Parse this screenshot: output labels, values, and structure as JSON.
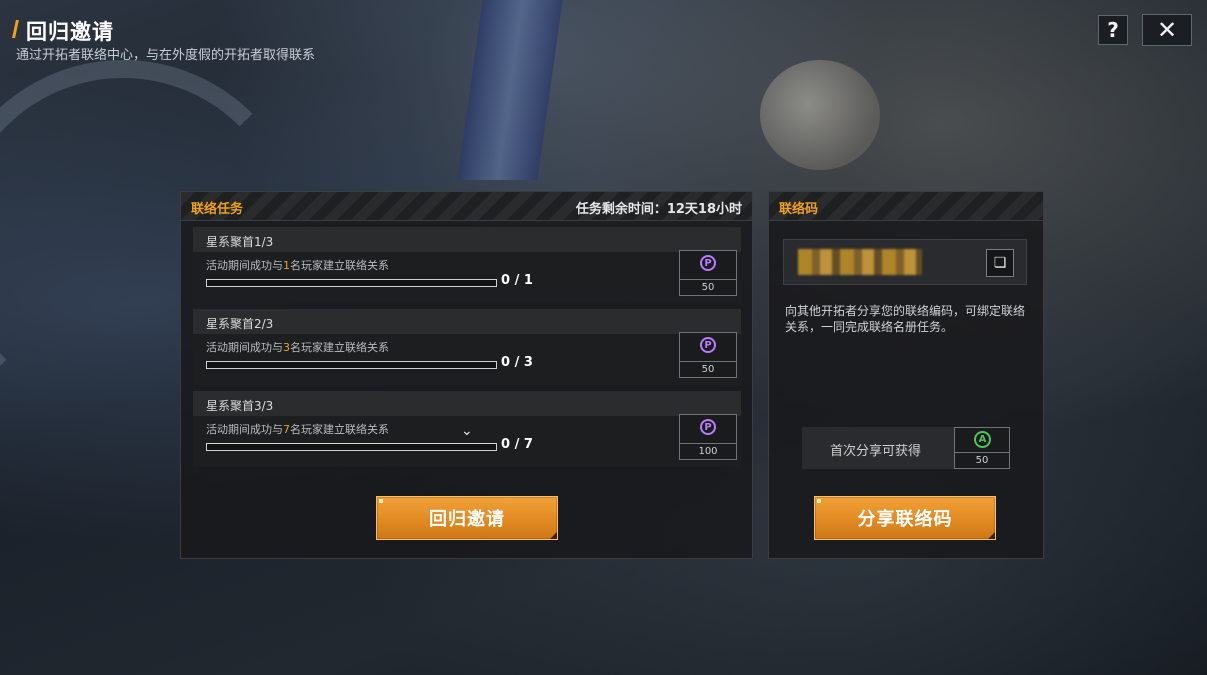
{
  "header": {
    "title": "回归邀请",
    "subtitle": "通过开拓者联络中心，与在外度假的开拓者取得联系",
    "help_icon": "?",
    "close_icon": "✕"
  },
  "task_panel": {
    "title": "联络任务",
    "remaining": "任务剩余时间：12天18小时",
    "tasks": [
      {
        "title": "星系聚首1/3",
        "desc_pre": "活动期间成功与",
        "desc_num": "1",
        "desc_post": "名玩家建立联络关系",
        "progress_text": "0 / 1",
        "progress": 0,
        "reward_count": "50",
        "reward_icon": "purple-coin-icon"
      },
      {
        "title": "星系聚首2/3",
        "desc_pre": "活动期间成功与",
        "desc_num": "3",
        "desc_post": "名玩家建立联络关系",
        "progress_text": "0 / 3",
        "progress": 0,
        "reward_count": "50",
        "reward_icon": "purple-coin-icon"
      },
      {
        "title": "星系聚首3/3",
        "desc_pre": "活动期间成功与",
        "desc_num": "7",
        "desc_post": "名玩家建立联络关系",
        "progress_text": "0 / 7",
        "progress": 0,
        "reward_count": "100",
        "reward_icon": "purple-coin-icon"
      }
    ],
    "invite_button": "回归邀请"
  },
  "code_panel": {
    "title": "联络码",
    "description": "向其他开拓者分享您的联络编码，可绑定联络关系，一同完成联络名册任务。",
    "first_share_label": "首次分享可获得",
    "first_share_reward": "50",
    "share_button": "分享联络码"
  },
  "colors": {
    "accent": "#f0a020",
    "purple_reward": "#b97bff",
    "green_reward": "#52c45a"
  }
}
